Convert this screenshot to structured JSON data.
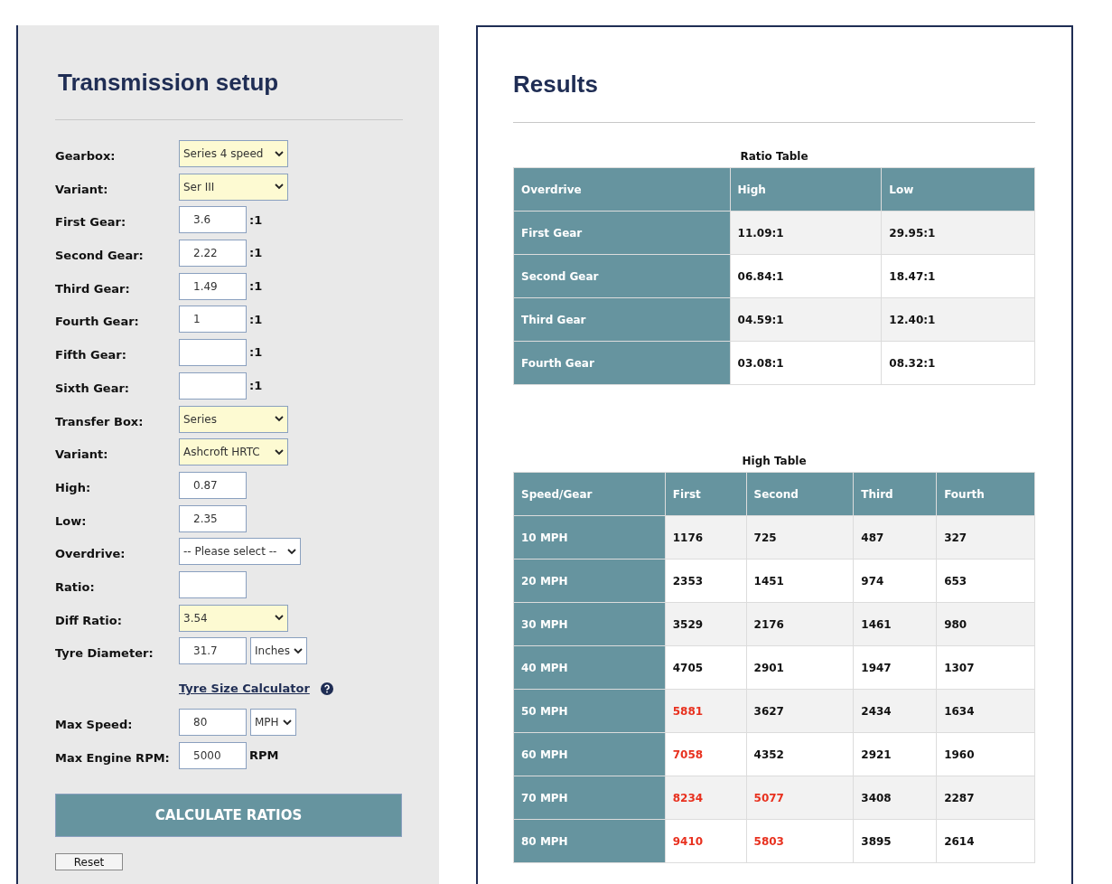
{
  "setup": {
    "title": "Transmission setup",
    "fields": [
      {
        "kind": "select",
        "label": "Gearbox:",
        "value": "Series 4 speed",
        "highlighted": true
      },
      {
        "kind": "select",
        "label": "Variant:",
        "value": "Ser III",
        "highlighted": true
      },
      {
        "kind": "input",
        "label": "First Gear:",
        "value": "3.6",
        "suffix": ":1"
      },
      {
        "kind": "input",
        "label": "Second Gear:",
        "value": "2.22",
        "suffix": ":1"
      },
      {
        "kind": "input",
        "label": "Third Gear:",
        "value": "1.49",
        "suffix": ":1"
      },
      {
        "kind": "input",
        "label": "Fourth Gear:",
        "value": "1",
        "suffix": ":1"
      },
      {
        "kind": "input",
        "label": "Fifth Gear:",
        "suffix": ":1"
      },
      {
        "kind": "input",
        "label": "Sixth Gear:",
        "suffix": ":1"
      },
      {
        "kind": "select",
        "label": "Transfer Box:",
        "value": "Series",
        "highlighted": true
      },
      {
        "kind": "select",
        "label": "Variant:",
        "value": "Ashcroft HRTC",
        "highlighted": true
      },
      {
        "kind": "input",
        "label": "High:",
        "value": "0.87"
      },
      {
        "kind": "input",
        "label": "Low:",
        "value": "2.35"
      },
      {
        "kind": "select",
        "label": "Overdrive:",
        "value": "-- Please select --",
        "highlighted": false
      },
      {
        "kind": "input",
        "label": "Ratio:"
      },
      {
        "kind": "select",
        "label": "Diff Ratio:",
        "value": "3.54",
        "highlighted": true
      },
      {
        "kind": "unit",
        "label": "Tyre Diameter:",
        "value": "31.7",
        "unit": "Inches"
      },
      {
        "kind": "link",
        "text": "Tyre Size Calculator"
      },
      {
        "kind": "unit",
        "label": "Max Speed:",
        "value": "80",
        "unit": "MPH"
      },
      {
        "kind": "input",
        "label": "Max Engine RPM:",
        "value": "5000",
        "suffix": "RPM"
      }
    ],
    "calculate": "CALCULATE RATIOS",
    "reset": "Reset"
  },
  "results": {
    "title": "Results",
    "tables": [
      {
        "caption": "Ratio Table",
        "columns": [
          "Overdrive",
          "High",
          "Low"
        ],
        "rows": [
          {
            "cells": [
              {
                "text": "First Gear"
              },
              {
                "text": "11.09:1",
                "alert": false
              },
              {
                "text": "29.95:1",
                "alert": false
              }
            ]
          },
          {
            "cells": [
              {
                "text": "Second Gear"
              },
              {
                "text": "06.84:1",
                "alert": false
              },
              {
                "text": "18.47:1",
                "alert": false
              }
            ]
          },
          {
            "cells": [
              {
                "text": "Third Gear"
              },
              {
                "text": "04.59:1",
                "alert": false
              },
              {
                "text": "12.40:1",
                "alert": false
              }
            ]
          },
          {
            "cells": [
              {
                "text": "Fourth Gear"
              },
              {
                "text": "03.08:1",
                "alert": false
              },
              {
                "text": "08.32:1",
                "alert": false
              }
            ]
          }
        ]
      },
      {
        "caption": "High Table",
        "columns": [
          "Speed/Gear",
          "First",
          "Second",
          "Third",
          "Fourth"
        ],
        "rows": [
          {
            "cells": [
              {
                "text": "10 MPH"
              },
              {
                "text": "1176",
                "alert": false
              },
              {
                "text": "725",
                "alert": false
              },
              {
                "text": "487",
                "alert": false
              },
              {
                "text": "327",
                "alert": false
              }
            ]
          },
          {
            "cells": [
              {
                "text": "20 MPH"
              },
              {
                "text": "2353",
                "alert": false
              },
              {
                "text": "1451",
                "alert": false
              },
              {
                "text": "974",
                "alert": false
              },
              {
                "text": "653",
                "alert": false
              }
            ]
          },
          {
            "cells": [
              {
                "text": "30 MPH"
              },
              {
                "text": "3529",
                "alert": false
              },
              {
                "text": "2176",
                "alert": false
              },
              {
                "text": "1461",
                "alert": false
              },
              {
                "text": "980",
                "alert": false
              }
            ]
          },
          {
            "cells": [
              {
                "text": "40 MPH"
              },
              {
                "text": "4705",
                "alert": false
              },
              {
                "text": "2901",
                "alert": false
              },
              {
                "text": "1947",
                "alert": false
              },
              {
                "text": "1307",
                "alert": false
              }
            ]
          },
          {
            "cells": [
              {
                "text": "50 MPH"
              },
              {
                "text": "5881",
                "alert": true
              },
              {
                "text": "3627",
                "alert": false
              },
              {
                "text": "2434",
                "alert": false
              },
              {
                "text": "1634",
                "alert": false
              }
            ]
          },
          {
            "cells": [
              {
                "text": "60 MPH"
              },
              {
                "text": "7058",
                "alert": true
              },
              {
                "text": "4352",
                "alert": false
              },
              {
                "text": "2921",
                "alert": false
              },
              {
                "text": "1960",
                "alert": false
              }
            ]
          },
          {
            "cells": [
              {
                "text": "70 MPH"
              },
              {
                "text": "8234",
                "alert": true
              },
              {
                "text": "5077",
                "alert": true
              },
              {
                "text": "3408",
                "alert": false
              },
              {
                "text": "2287",
                "alert": false
              }
            ]
          },
          {
            "cells": [
              {
                "text": "80 MPH"
              },
              {
                "text": "9410",
                "alert": true
              },
              {
                "text": "5803",
                "alert": true
              },
              {
                "text": "3895",
                "alert": false
              },
              {
                "text": "2614",
                "alert": false
              }
            ]
          }
        ]
      }
    ]
  }
}
